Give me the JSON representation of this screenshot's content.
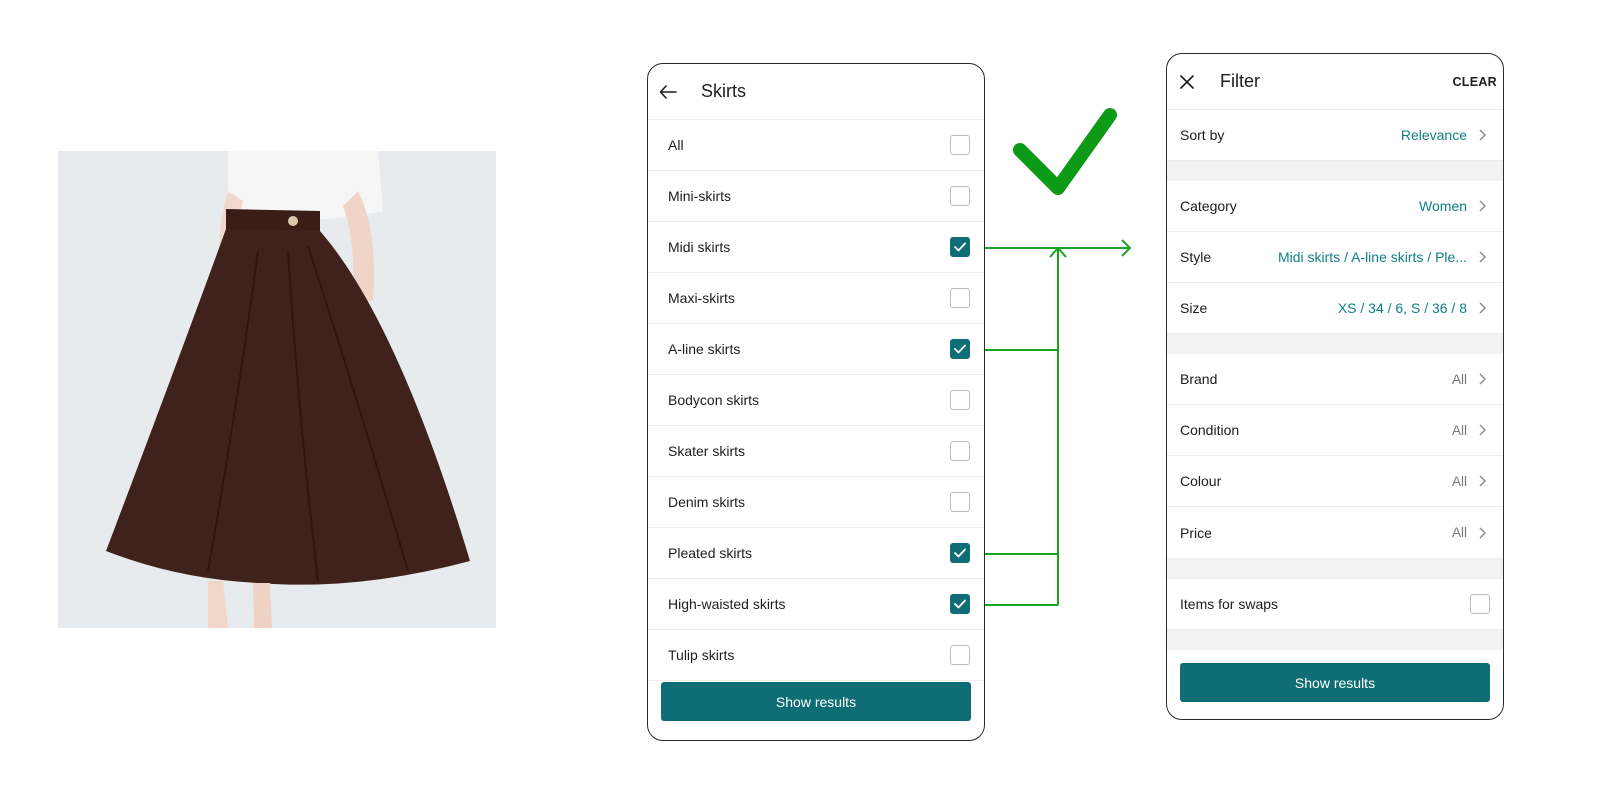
{
  "colors": {
    "teal": "#0f6d75",
    "connector_green": "#1aa322",
    "check_green": "#0c9a17"
  },
  "photo": {
    "icon": "product-photo-skirt"
  },
  "skirts_screen": {
    "back_icon": "arrow-left-icon",
    "title": "Skirts",
    "items": [
      {
        "label": "All",
        "checked": false
      },
      {
        "label": "Mini-skirts",
        "checked": false
      },
      {
        "label": "Midi skirts",
        "checked": true
      },
      {
        "label": "Maxi-skirts",
        "checked": false
      },
      {
        "label": "A-line skirts",
        "checked": true
      },
      {
        "label": "Bodycon skirts",
        "checked": false
      },
      {
        "label": "Skater skirts",
        "checked": false
      },
      {
        "label": "Denim skirts",
        "checked": false
      },
      {
        "label": "Pleated skirts",
        "checked": true
      },
      {
        "label": "High-waisted skirts",
        "checked": true
      },
      {
        "label": "Tulip skirts",
        "checked": false
      }
    ],
    "show_results": "Show results"
  },
  "filter_screen": {
    "close_icon": "close-icon",
    "title": "Filter",
    "clear": "CLEAR",
    "sort_by": {
      "label": "Sort by",
      "value": "Relevance"
    },
    "category": {
      "label": "Category",
      "value": "Women"
    },
    "style": {
      "label": "Style",
      "value": "Midi skirts / A-line skirts / Ple..."
    },
    "size": {
      "label": "Size",
      "value": "XS / 34 / 6, S / 36 / 8"
    },
    "brand": {
      "label": "Brand",
      "value": "All"
    },
    "condition": {
      "label": "Condition",
      "value": "All"
    },
    "colour": {
      "label": "Colour",
      "value": "All"
    },
    "price": {
      "label": "Price",
      "value": "All"
    },
    "swaps": {
      "label": "Items for swaps",
      "checked": false
    },
    "show_results": "Show results"
  }
}
